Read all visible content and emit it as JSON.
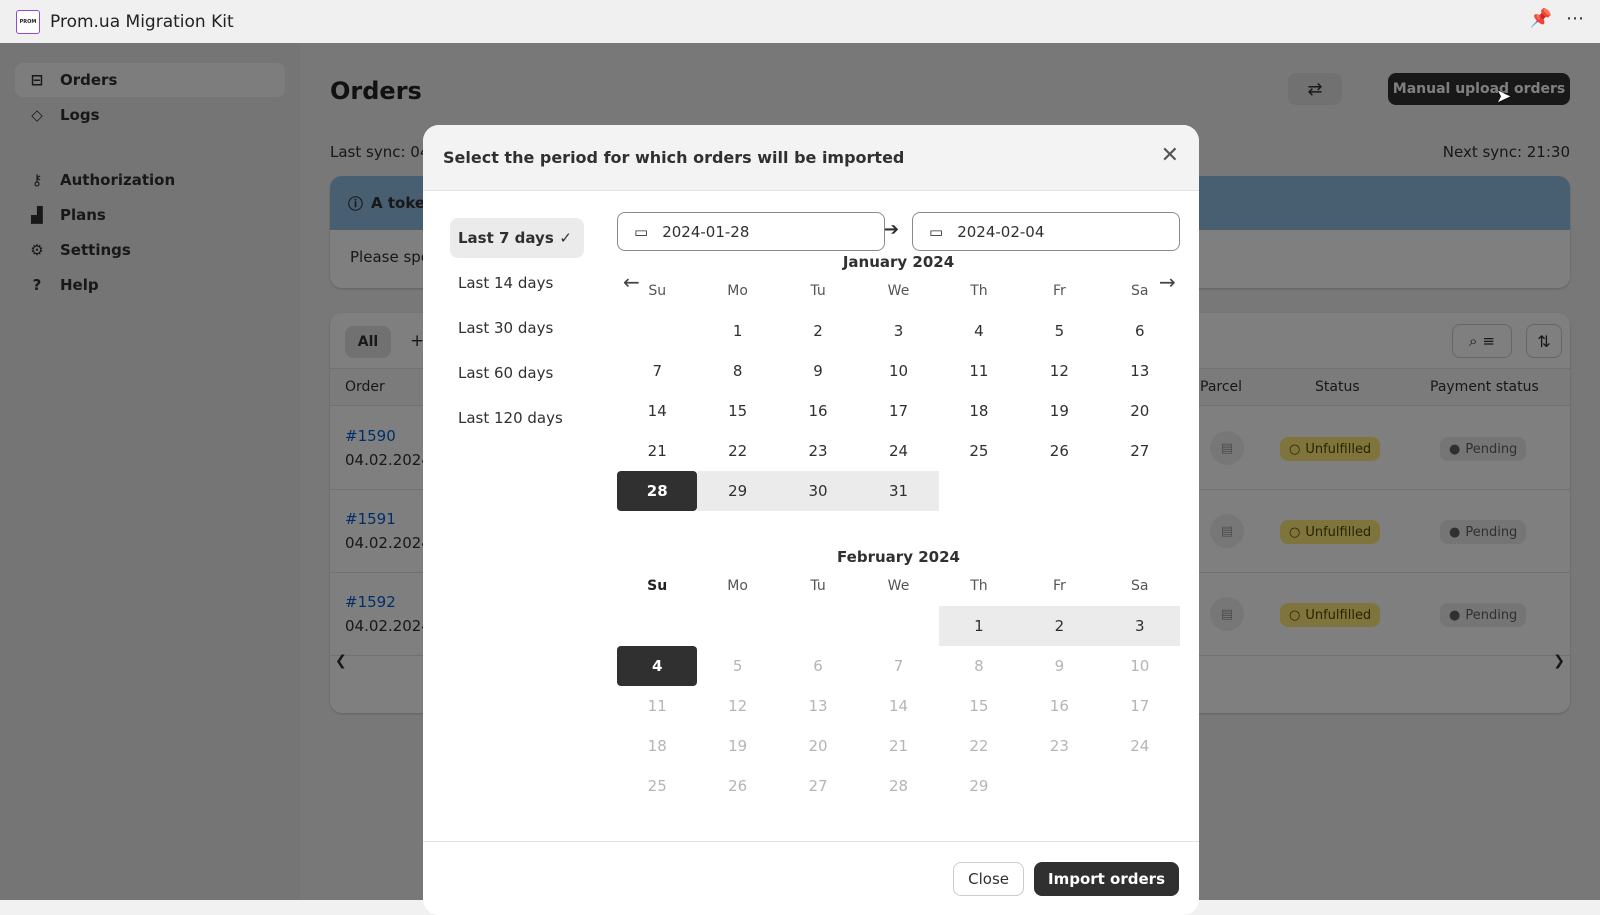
{
  "window": {
    "title": "Prom.ua Migration Kit",
    "logo_text": "PROM",
    "pin_icon": "pin-icon",
    "more_icon": "more-icon"
  },
  "sidebar": {
    "items": [
      {
        "label": "Orders",
        "icon": "inbox-icon",
        "active": true
      },
      {
        "label": "Logs",
        "icon": "alert-diamond-icon"
      },
      {
        "label": "Authorization",
        "icon": "key-icon"
      },
      {
        "label": "Plans",
        "icon": "stairs-icon"
      },
      {
        "label": "Settings",
        "icon": "gear-icon"
      },
      {
        "label": "Help",
        "icon": "help-icon"
      }
    ]
  },
  "main": {
    "title": "Orders",
    "upload_label": "Manual upload orders",
    "last_sync": "Last sync: 04.",
    "next_sync": "Next sync: 21:30",
    "banner_title": "A toke",
    "banner_body": "Please spe",
    "tab_all": "All",
    "tab_add": "+",
    "columns": {
      "order": "Order",
      "parcel": "Parcel",
      "status": "Status",
      "payment": "Payment status"
    },
    "rows": [
      {
        "number": "#1590",
        "date": "04.02.2024,",
        "status": "Unfulfilled",
        "payment": "Pending"
      },
      {
        "number": "#1591",
        "date": "04.02.2024,",
        "status": "Unfulfilled",
        "payment": "Pending"
      },
      {
        "number": "#1592",
        "date": "04.02.2024,",
        "status": "Unfulfilled",
        "payment": "Pending"
      }
    ]
  },
  "modal": {
    "title": "Select the period for which orders will be imported",
    "presets": [
      "Last 7 days",
      "Last 14 days",
      "Last 30 days",
      "Last 60 days",
      "Last 120 days"
    ],
    "selected_preset": "Last 7 days",
    "start_date": "2024-01-28",
    "end_date": "2024-02-04",
    "weekdays": [
      "Su",
      "Mo",
      "Tu",
      "We",
      "Th",
      "Fr",
      "Sa"
    ],
    "months": [
      {
        "title": "January 2024",
        "first_weekday": 1,
        "days": 31,
        "range_start": 28,
        "range_end": 31,
        "selected": [
          28
        ],
        "disabled_after": null
      },
      {
        "title": "February 2024",
        "first_weekday": 4,
        "days": 29,
        "range_start": 1,
        "range_end": 4,
        "selected": [
          4
        ],
        "disabled_after": 4
      }
    ],
    "close_label": "Close",
    "import_label": "Import orders"
  },
  "colors": {
    "primary": "#303030",
    "accent_link": "#005bd3",
    "badge_unfulfilled": "#ffeb78",
    "banner": "#91bde3"
  }
}
